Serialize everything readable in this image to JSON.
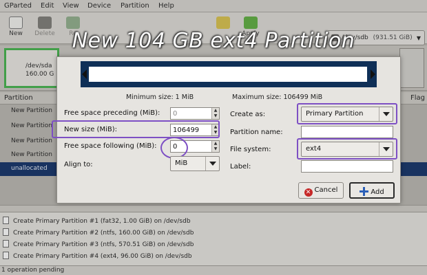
{
  "banner": {
    "title": "New 104 GB ext4 Partition"
  },
  "menubar": {
    "items": [
      "GParted",
      "Edit",
      "View",
      "Device",
      "Partition",
      "Help"
    ]
  },
  "toolbar": {
    "new_label": "New",
    "delete_label": "Delete",
    "resize_label": "Re",
    "apply_label": "Apply",
    "device_name": "/dev/sdb",
    "device_size": "(931.51 GiB)"
  },
  "diskmap": {
    "line1": "/dev/sda",
    "line2": "160.00 G"
  },
  "grid": {
    "col_partition": "Partition",
    "col_flags": "Flag",
    "rows": [
      "New Partition",
      "New Partition",
      "New Partition",
      "New Partition",
      "unallocated"
    ]
  },
  "dialog": {
    "min_size": "Minimum size: 1 MiB",
    "max_size": "Maximum size: 106499 MiB",
    "preceding_label": "Free space preceding (MiB):",
    "preceding_value": "0",
    "newsize_label": "New size (MiB):",
    "newsize_value": "106499",
    "following_label": "Free space following (MiB):",
    "following_value": "0",
    "align_label": "Align to:",
    "align_value": "MiB",
    "createas_label": "Create as:",
    "createas_value": "Primary Partition",
    "partname_label": "Partition name:",
    "partname_value": "",
    "filesystem_label": "File system:",
    "filesystem_value": "ext4",
    "label_label": "Label:",
    "label_value": "",
    "cancel_label": "Cancel",
    "add_label": "Add"
  },
  "pending": {
    "operations": [
      "Create Primary Partition #1 (fat32, 1.00 GiB) on /dev/sdb",
      "Create Primary Partition #2 (ntfs, 160.00 GiB) on /dev/sdb",
      "Create Primary Partition #3 (ntfs, 570.51 GiB) on /dev/sdb",
      "Create Primary Partition #4 (ext4, 96.00 GiB) on /dev/sdb"
    ],
    "status": "1 operation pending"
  },
  "colors": {
    "accent_highlight": "#7d4fc4",
    "selection": "#0f2f66",
    "partition_border": "#41b34a",
    "bar": "#0f2f57"
  },
  "icons": [
    "new-icon",
    "delete-icon",
    "resize-icon",
    "undo-icon",
    "apply-icon",
    "hdd-icon",
    "cancel-icon",
    "add-icon",
    "operation-icon"
  ]
}
